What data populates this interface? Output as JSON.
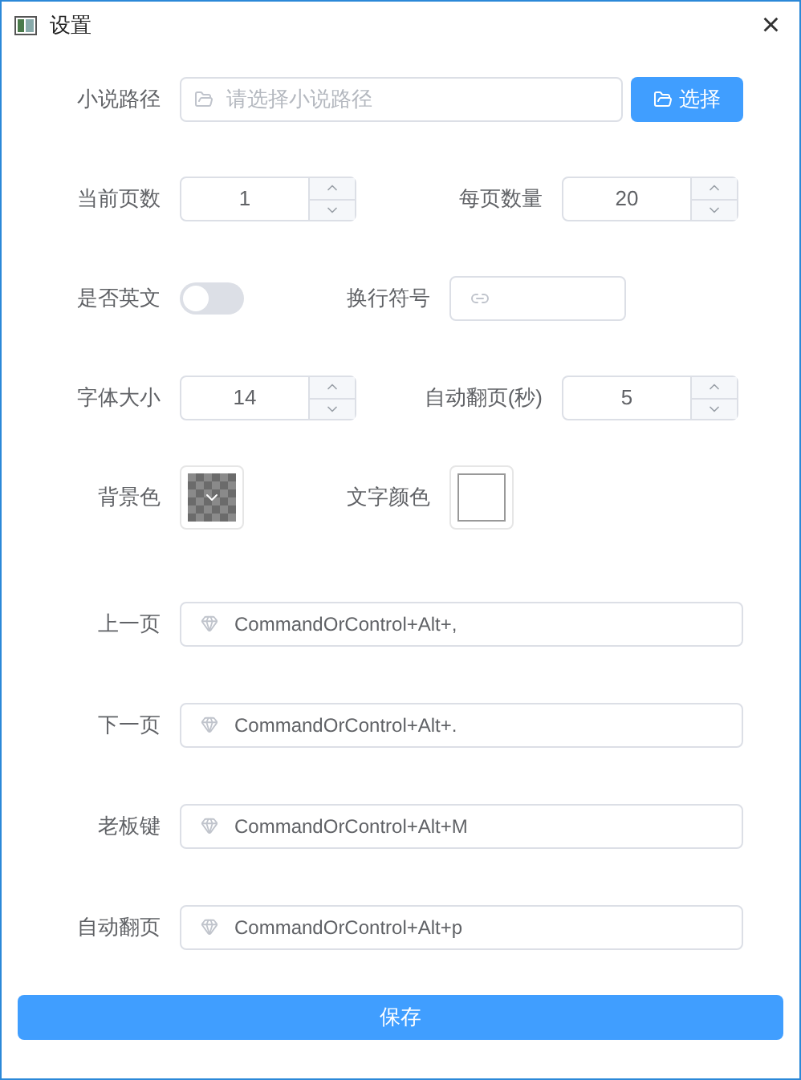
{
  "window": {
    "title": "设置",
    "close": "×"
  },
  "path": {
    "label": "小说路径",
    "placeholder": "请选择小说路径",
    "button": "选择"
  },
  "settings": [
    {
      "kind": "number",
      "label": "当前页数",
      "value": "1"
    },
    {
      "kind": "number",
      "label": "每页数量",
      "value": "20"
    },
    {
      "kind": "switch",
      "label": "是否英文",
      "on": false
    },
    {
      "kind": "text",
      "label": "换行符号"
    },
    {
      "kind": "number",
      "label": "字体大小",
      "value": "14"
    },
    {
      "kind": "number",
      "label": "自动翻页(秒)",
      "value": "5"
    },
    {
      "kind": "color",
      "label": "背景色"
    },
    {
      "kind": "color",
      "label": "文字颜色",
      "color": "#ffffff"
    }
  ],
  "shortcuts": [
    {
      "label": "上一页",
      "value": "CommandOrControl+Alt+,"
    },
    {
      "label": "下一页",
      "value": "CommandOrControl+Alt+."
    },
    {
      "label": "老板键",
      "value": "CommandOrControl+Alt+M"
    },
    {
      "label": "自动翻页",
      "value": "CommandOrControl+Alt+p"
    }
  ],
  "save_button": "保存"
}
